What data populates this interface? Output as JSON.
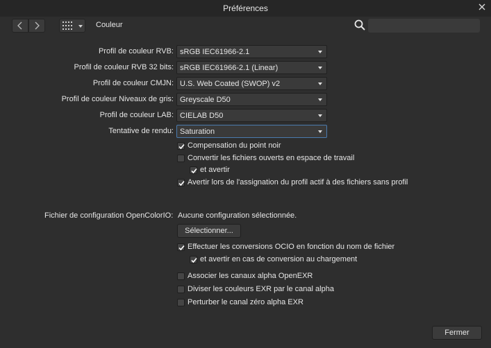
{
  "window": {
    "title": "Préférences"
  },
  "toolbar": {
    "section": "Couleur",
    "search_placeholder": ""
  },
  "profiles": [
    {
      "label": "Profil de couleur RVB:",
      "value": "sRGB IEC61966-2.1"
    },
    {
      "label": "Profil de couleur RVB 32 bits:",
      "value": "sRGB IEC61966-2.1 (Linear)"
    },
    {
      "label": "Profil de couleur CMJN:",
      "value": "U.S. Web Coated (SWOP) v2"
    },
    {
      "label": "Profil de couleur Niveaux de gris:",
      "value": "Greyscale D50"
    },
    {
      "label": "Profil de couleur LAB:",
      "value": "CIELAB D50"
    },
    {
      "label": "Tentative de rendu:",
      "value": "Saturation"
    }
  ],
  "options": [
    {
      "label": "Compensation du point noir",
      "checked": true
    },
    {
      "label": "Convertir les fichiers ouverts en espace de travail",
      "checked": false
    },
    {
      "label": "et avertir",
      "checked": true
    },
    {
      "label": "Avertir lors de l'assignation du profil actif à des fichiers sans profil",
      "checked": true
    }
  ],
  "ocio": {
    "label": "Fichier de configuration OpenColorIO:",
    "value": "Aucune configuration sélectionnée.",
    "select_button": "Sélectionner..."
  },
  "ocio_options": [
    {
      "label": "Effectuer les conversions OCIO en fonction du nom de fichier",
      "checked": true
    },
    {
      "label": "et avertir en cas de conversion au chargement",
      "checked": true
    }
  ],
  "exr_options": [
    {
      "label": "Associer les canaux alpha OpenEXR",
      "checked": false
    },
    {
      "label": "Diviser les couleurs EXR par le canal alpha",
      "checked": false
    },
    {
      "label": "Perturber le canal zéro alpha EXR",
      "checked": false
    }
  ],
  "footer": {
    "close_button": "Fermer"
  },
  "colors": {
    "background": "#2e2e2e",
    "titlebar": "#262626",
    "focus": "#4a7bb0"
  }
}
